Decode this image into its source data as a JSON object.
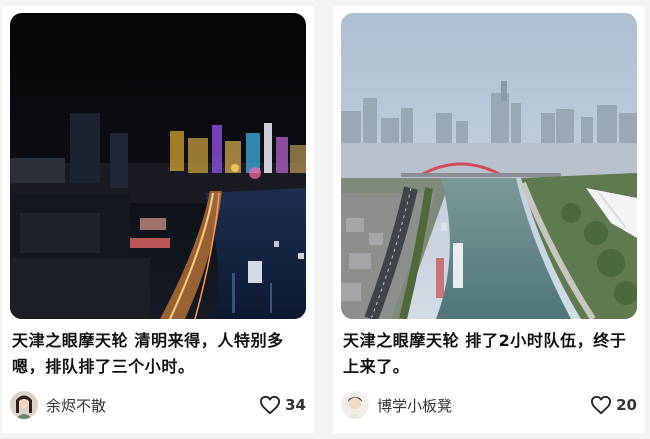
{
  "feed": {
    "cards": [
      {
        "photo": "night-city-river-photo",
        "caption": "天津之眼摩天轮 清明来得，人特别多嗯，排队排了三个小时。",
        "author": "余烬不散",
        "likes": "34",
        "like_icon": "heart-outline-icon"
      },
      {
        "photo": "day-city-river-photo",
        "caption": "天津之眼摩天轮 排了2小时队伍，终于上来了。",
        "author": "博学小板凳",
        "likes": "20",
        "like_icon": "heart-outline-icon"
      }
    ]
  }
}
